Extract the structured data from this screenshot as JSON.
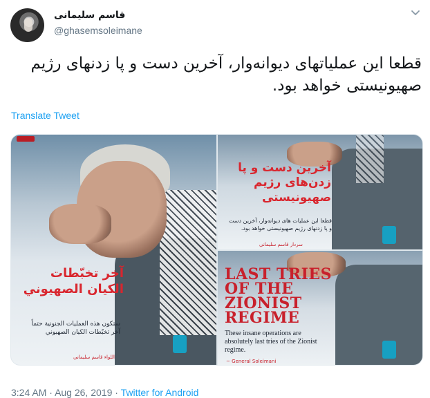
{
  "author": {
    "name": "قاسم سلیمانی",
    "handle": "@ghasemsoleimane"
  },
  "tweet": {
    "text": "قطعا این عملیاتهای دیوانه‌وار، آخرین دست و پا زدنهای رژیم صهیونیستی خواهد بود.",
    "translate_label": "Translate Tweet"
  },
  "media": {
    "left": {
      "title": "آخر تخبّطات الكيان الصهيوني",
      "subtitle": "ستكون هذه العمليات الجنونية حتماً آخر تخبّطات الكيان الصهيوني",
      "signature": "اللواء قاسم سليماني"
    },
    "top_right": {
      "title": "آخرین دست و پا زدن‌های رژیم صهیونیستی",
      "subtitle": "قطعا این عملیات های دیوانه‌وار، آخرین دست و پا زدنهای رژیم صهیونیستی خواهد بود.",
      "signature": "سردار قاسم سلیمانی"
    },
    "bottom_right": {
      "title": "LAST TRIES OF THE ZIONIST REGIME",
      "subtitle": "These insane operations are absolutely last tries of the Zionist regime.",
      "signature": "~ General Soleimani"
    }
  },
  "footer": {
    "time": "3:24 AM",
    "separator": "·",
    "date": "Aug 26, 2019",
    "source": "Twitter for Android"
  },
  "icons": {
    "menu": "chevron-down-icon"
  },
  "colors": {
    "link": "#1da1f2",
    "secondary_text": "#657786",
    "poster_red": "#c8202b"
  }
}
